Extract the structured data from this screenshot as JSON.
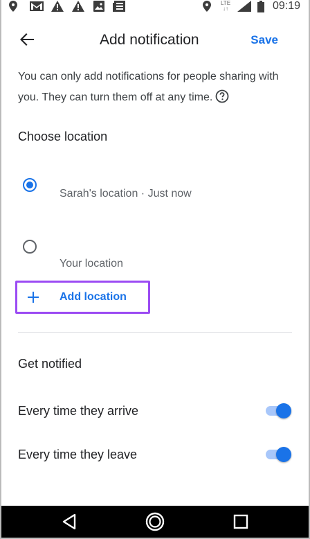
{
  "status_bar": {
    "time": "09:19",
    "network_label": "LTE",
    "icons": [
      "location-pin-icon",
      "gmail-icon",
      "warning-icon",
      "warning-icon",
      "image-icon",
      "news-icon",
      "location-pin-icon",
      "signal-icon",
      "battery-icon"
    ]
  },
  "app_bar": {
    "title": "Add notification",
    "save_label": "Save",
    "back_icon": "arrow-back-icon"
  },
  "info": {
    "text": "You can only add notifications for people sharing with you. They can turn them off at any time.",
    "help_icon": "help-circle-icon"
  },
  "choose_location": {
    "heading": "Choose location",
    "options": [
      {
        "label": "Sarah's location · Just now",
        "selected": true
      },
      {
        "label": "Your location",
        "selected": false
      }
    ],
    "add_label": "Add location",
    "add_icon": "plus-icon"
  },
  "get_notified": {
    "heading": "Get notified",
    "options": [
      {
        "label": "Every time they arrive",
        "enabled": true
      },
      {
        "label": "Every time they leave",
        "enabled": true
      }
    ]
  },
  "nav_bar": {
    "icons": [
      "back-triangle-icon",
      "home-circle-icon",
      "recents-square-icon"
    ]
  },
  "colors": {
    "accent": "#1a73e8",
    "highlight_border": "#9b4bf3",
    "text_primary": "#202124",
    "text_secondary": "#5f6368"
  }
}
